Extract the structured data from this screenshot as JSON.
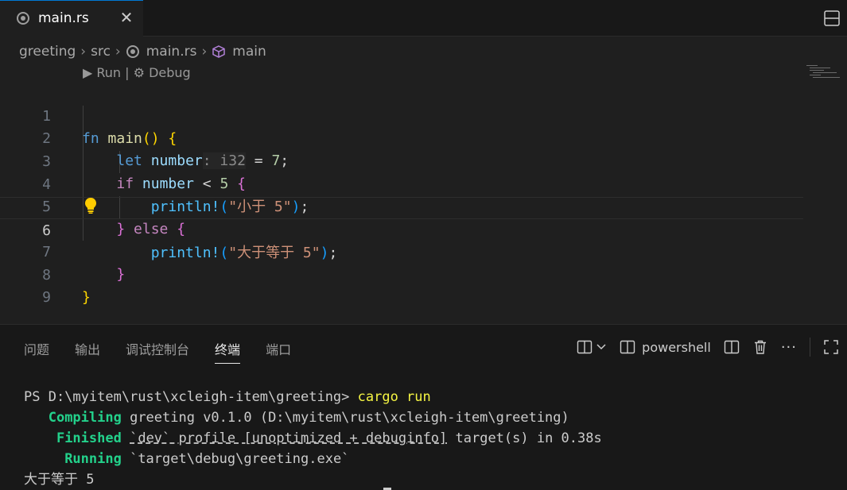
{
  "tab": {
    "label": "main.rs",
    "close": "✕"
  },
  "breadcrumb": {
    "items": [
      "greeting",
      "src",
      "main.rs",
      "main"
    ],
    "separator": "›"
  },
  "codelens": {
    "run": "▶ Run",
    "sep": " | ",
    "debug": "⚙ Debug"
  },
  "editor": {
    "line_numbers": [
      "1",
      "2",
      "3",
      "4",
      "5",
      "6",
      "7",
      "8",
      "9"
    ],
    "current_line": 6,
    "tokens": {
      "fn": "fn",
      "main": "main",
      "paren": "()",
      "lbrace": "{",
      "rbrace": "}",
      "let": "let",
      "number": "number",
      "hint_type": ": i32",
      "eq": " = ",
      "seven": "7",
      "semi": ";",
      "if": "if",
      "lt": " < ",
      "five": "5",
      "println": "println!",
      "lparen": "(",
      "rparen": ")",
      "str1": "\"小于 5\"",
      "else": "else",
      "str2": "\"大于等于 5\""
    }
  },
  "panel": {
    "tabs": [
      "问题",
      "输出",
      "调试控制台",
      "终端",
      "端口"
    ],
    "active_tab": "终端",
    "shell": "powershell",
    "more": "···"
  },
  "terminal": {
    "prompt": "PS D:\\myitem\\rust\\xcleigh-item\\greeting> ",
    "command": "cargo run",
    "compiling_label": "Compiling",
    "compiling_text": " greeting v0.1.0 (D:\\myitem\\rust\\xcleigh-item\\greeting)",
    "finished_label": "Finished",
    "finished_profile": "`dev` profile [unoptimized + debuginfo]",
    "finished_rest": " target(s) in 0.38s",
    "running_label": "Running",
    "running_text": " `target\\debug\\greeting.exe`",
    "output": "大于等于 5"
  },
  "icons": {
    "rust_file": "rust-icon",
    "symbol": "cube-icon",
    "bulb": "lightbulb-icon"
  }
}
